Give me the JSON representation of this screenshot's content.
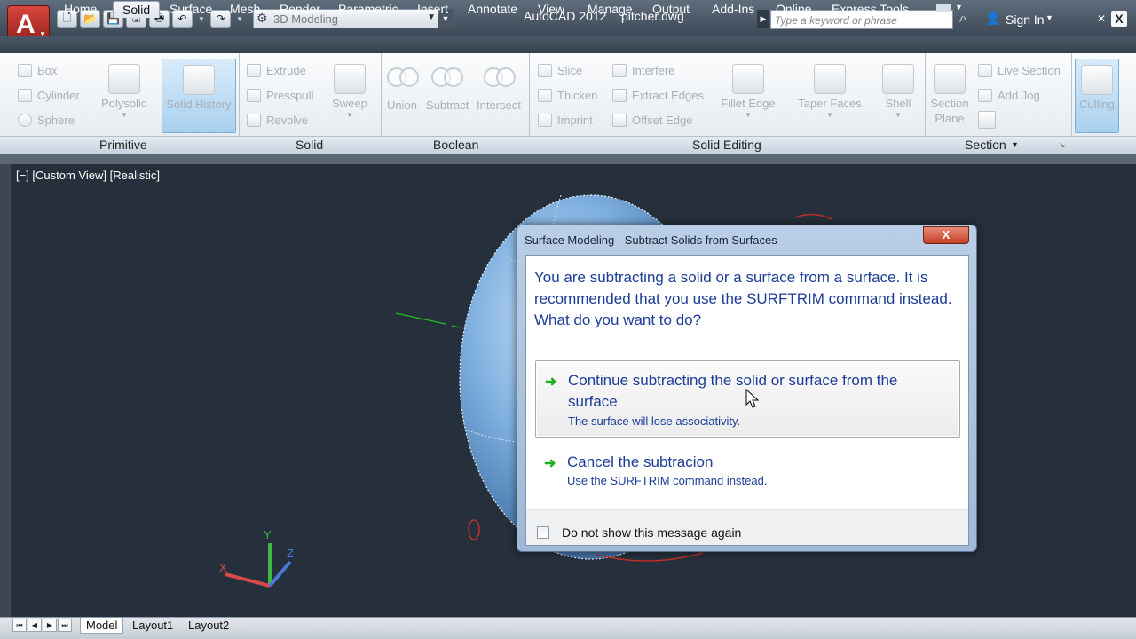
{
  "titlebar": {
    "workspace": "3D Modeling",
    "app_title": "AutoCAD 2012",
    "file_title": "pitcher.dwg",
    "search_placeholder": "Type a keyword or phrase",
    "sign_in": "Sign In",
    "close_glyph": "X"
  },
  "tabs": [
    "Home",
    "Solid",
    "Surface",
    "Mesh",
    "Render",
    "Parametric",
    "Insert",
    "Annotate",
    "View",
    "Manage",
    "Output",
    "Add-Ins",
    "Online",
    "Express Tools"
  ],
  "active_tab": "Solid",
  "ribbon": {
    "primitive": {
      "title": "Primitive",
      "box": "Box",
      "cylinder": "Cylinder",
      "sphere": "Sphere",
      "polysolid": "Polysolid",
      "solid_history": "Solid History"
    },
    "solid": {
      "title": "Solid",
      "extrude": "Extrude",
      "presspull": "Presspull",
      "revolve": "Revolve",
      "sweep": "Sweep"
    },
    "boolean": {
      "title": "Boolean",
      "union": "Union",
      "subtract": "Subtract",
      "intersect": "Intersect"
    },
    "solid_editing": {
      "title": "Solid Editing",
      "slice": "Slice",
      "thicken": "Thicken",
      "imprint": "Imprint",
      "interfere": "Interfere",
      "extract_edges": "Extract Edges",
      "offset_edge": "Offset Edge",
      "fillet_edge": "Fillet Edge",
      "taper_faces": "Taper Faces",
      "shell": "Shell"
    },
    "section": {
      "title": "Section",
      "section_plane_1": "Section",
      "section_plane_2": "Plane",
      "live_section": "Live Section",
      "add_jog": "Add Jog"
    },
    "culling": "Culling"
  },
  "viewport": {
    "label": "[−] [Custom View] [Realistic]",
    "ucs_x": "X",
    "ucs_y": "Y",
    "ucs_z": "Z"
  },
  "bottom_tabs": [
    "Model",
    "Layout1",
    "Layout2"
  ],
  "dialog": {
    "title": "Surface Modeling - Subtract Solids from Surfaces",
    "close": "X",
    "message": "You are subtracting a solid or a surface from a surface. It is recommended that you use the SURFTRIM command instead. What do you want to do?",
    "option1_main": "Continue subtracting the solid or surface from the surface",
    "option1_sub": "The surface will lose associativity.",
    "option2_main": "Cancel the subtracion",
    "option2_sub": "Use the SURFTRIM command instead.",
    "checkbox_label": "Do not show this message again"
  },
  "colors": {
    "app_red": "#c0302a",
    "viewport_bg": "#25303c",
    "link_blue": "#1c3d97",
    "arrow_green": "#20b020",
    "surface_blue": "#6c9dd0"
  },
  "icons": [
    "autocad-logo-icon",
    "new-icon",
    "open-icon",
    "save-icon",
    "save-as-icon",
    "plot-icon",
    "undo-icon",
    "redo-icon",
    "binoculars-icon",
    "user-icon"
  ]
}
